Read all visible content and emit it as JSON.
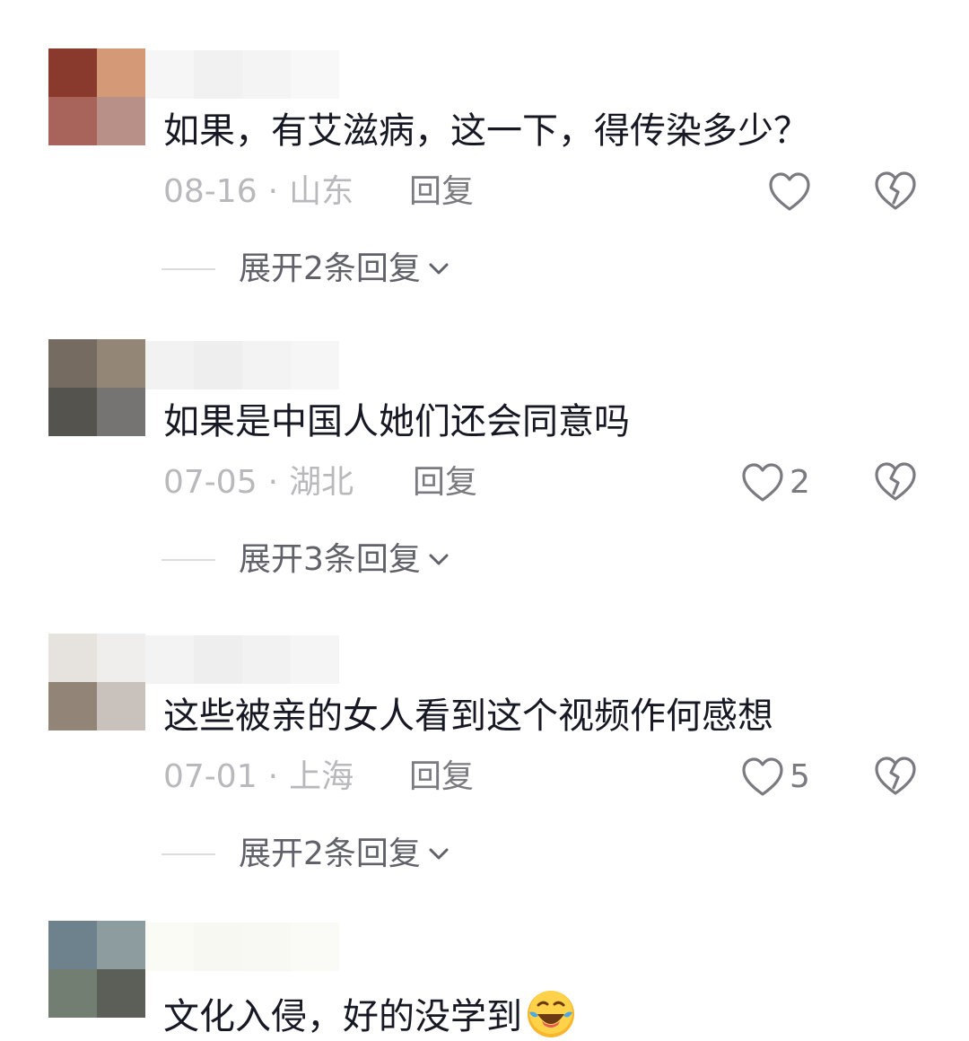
{
  "comments": [
    {
      "text": "如果，有艾滋病，这一下，得传染多少？",
      "date": "08-16",
      "location": "山东",
      "reply_label": "回复",
      "like_count": "",
      "expand_label": "展开2条回复",
      "avatar_colors": [
        "#8a3a2c",
        "#d49a78",
        "#a8645a",
        "#b89088"
      ],
      "name_colors": [
        "#f6f6f6",
        "#f1f1f1",
        "#f4f4f4",
        "#f8f8f8"
      ]
    },
    {
      "text": "如果是中国人她们还会同意吗",
      "date": "07-05",
      "location": "湖北",
      "reply_label": "回复",
      "like_count": "2",
      "expand_label": "展开3条回复",
      "avatar_colors": [
        "#756b60",
        "#948676",
        "#54534e",
        "#767472"
      ],
      "name_colors": [
        "#f2f2f2",
        "#eeeeee",
        "#f3f3f3",
        "#f6f6f6"
      ]
    },
    {
      "text": "这些被亲的女人看到这个视频作何感想",
      "date": "07-01",
      "location": "上海",
      "reply_label": "回复",
      "like_count": "5",
      "expand_label": "展开2条回复",
      "avatar_colors": [
        "#e6e2de",
        "#f0eeec",
        "#928577",
        "#c9c2bc"
      ],
      "name_colors": [
        "#f3f3f3",
        "#eeeeee",
        "#f2f2f2",
        "#f5f5f5"
      ]
    },
    {
      "text": "文化入侵，好的没学到",
      "emoji": "laughing-crying-emoji",
      "avatar_colors": [
        "#6e828e",
        "#8d9c9e",
        "#727e72",
        "#5c5e58"
      ],
      "name_colors": [
        "#fbfbf6",
        "#f8f8f2",
        "#f9f9f4",
        "#fafaf6"
      ]
    }
  ],
  "meta_separator": "·",
  "icons": {
    "like": "heart-outline-icon",
    "dislike": "broken-heart-icon",
    "expand": "chevron-down-icon"
  },
  "colors": {
    "text": "#161823",
    "meta": "#b8b8bd",
    "secondary": "#7a7a80"
  }
}
